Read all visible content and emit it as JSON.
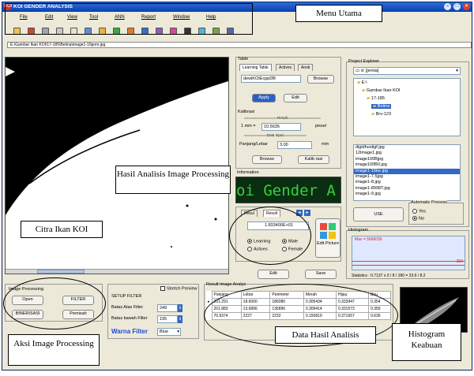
{
  "window": {
    "title": "KOI GENDER ANALYSIS",
    "logo": "KOI"
  },
  "menus": [
    "File",
    "Edit",
    "View",
    "Tool",
    "ANN",
    "Report",
    "Window",
    "Help"
  ],
  "path_text": "E:\\Gambar Ikan KOI\\17-185\\Betina\\image1-10gnm.jpg",
  "table_panel": {
    "label": "Table",
    "tabs": [
      "Learning Table",
      "Actives",
      "Ansb"
    ],
    "file_value": "dewiKOIEcppDB",
    "browse": "Browse",
    "apply": "Apply",
    "edit": "Edit"
  },
  "kalibrasi": {
    "label": "Kalibrasi",
    "result_header": "================Result================",
    "unit_prefix": "1 mm =",
    "unit_value": "10.5635",
    "unit_suffix": "pixsel",
    "data_header": "===========Data Input===========",
    "length_label": "Panjang/Lebar",
    "length_value": "3.00",
    "length_unit": "mm",
    "browse": "Browse",
    "calibrate": "Kalib rasi"
  },
  "info": {
    "label": "Information",
    "ticker": "oi Gender A"
  },
  "result_panel": {
    "tabs": [
      "Resul",
      "Result"
    ],
    "value": "1.833400E+01",
    "mode_options": [
      "Learning",
      "Actives"
    ],
    "gender_options": [
      "Male",
      "Female"
    ],
    "edit_picture": "Edit Picture"
  },
  "edit_btn": "Edit",
  "save_btn": "Save",
  "project": {
    "label": "Project Explorer",
    "drive": "d: [jernia]",
    "folders": [
      "E:\\",
      "Gambar Ikan KOI",
      "17-185",
      "Betina",
      "Brv-123"
    ],
    "files": [
      "digidhuoligf.jpg",
      "12image1.jpg",
      "image100Bjpg",
      "image100B0.jpg",
      "image1-16be.jpg",
      "image1-7.5jpg",
      "image1-8.jpg",
      "image1-8998T.jpg",
      "image1-9.jpg"
    ],
    "selected_file_index": 4,
    "use": "USE",
    "auto_label": "Automatic Process",
    "auto_options": [
      "Yes",
      "No"
    ]
  },
  "histogram": {
    "label": "Histogram",
    "max_text": "Max = 5666036",
    "right_marker": "250",
    "statistics": "Statistics : 0.7137 x 0 / 8 / 180 = 33.6 / 8.2"
  },
  "image_processing": {
    "label": "Image Processing",
    "buttons": [
      "Open",
      "FILTER",
      "BINERISASI",
      "Pemisah"
    ]
  },
  "setup_filter": {
    "label": "SETUP FILTER",
    "preview": "Stretch Preview",
    "upper_label": "Batas Atas Filter",
    "upper_value": "249",
    "lower_label": "Batas bawah Filter",
    "lower_value": "195",
    "color_label": "Warna Filter",
    "color_value": "Blue"
  },
  "result_table": {
    "label": "Result Image Analys",
    "headers": [
      "Panjang",
      "Lebar",
      "Perimeter",
      "Merah",
      "Hijau",
      "Biru"
    ],
    "rows": [
      [
        "201.291",
        "18.6000",
        "186080",
        "0.305434",
        "0.333947",
        "0.354"
      ],
      [
        "201.883",
        "13.6896",
        "136896",
        "0.309414",
        "0.331573",
        "0.359"
      ],
      [
        "70.9374",
        "2227",
        "2232",
        "0.150819",
        "0.371657",
        "0.636"
      ]
    ]
  },
  "callouts": {
    "menu_utama": "Menu Utama",
    "hasil_analisis": "Hasil Analisis Image Processing",
    "citra_ikan": "Citra Ikan KOI",
    "aksi_image": "Aksi Image Processing",
    "data_hasil": "Data Hasil Analisis",
    "histogram_keabuan": "Histogram Keabuan"
  },
  "colors": {
    "titlebar": "#0a3fb0",
    "ticker_bg": "#0b2d12",
    "ticker_fg": "#33d33a",
    "histogram_bg": "#dfe8ff",
    "selection": "#3169c6"
  }
}
